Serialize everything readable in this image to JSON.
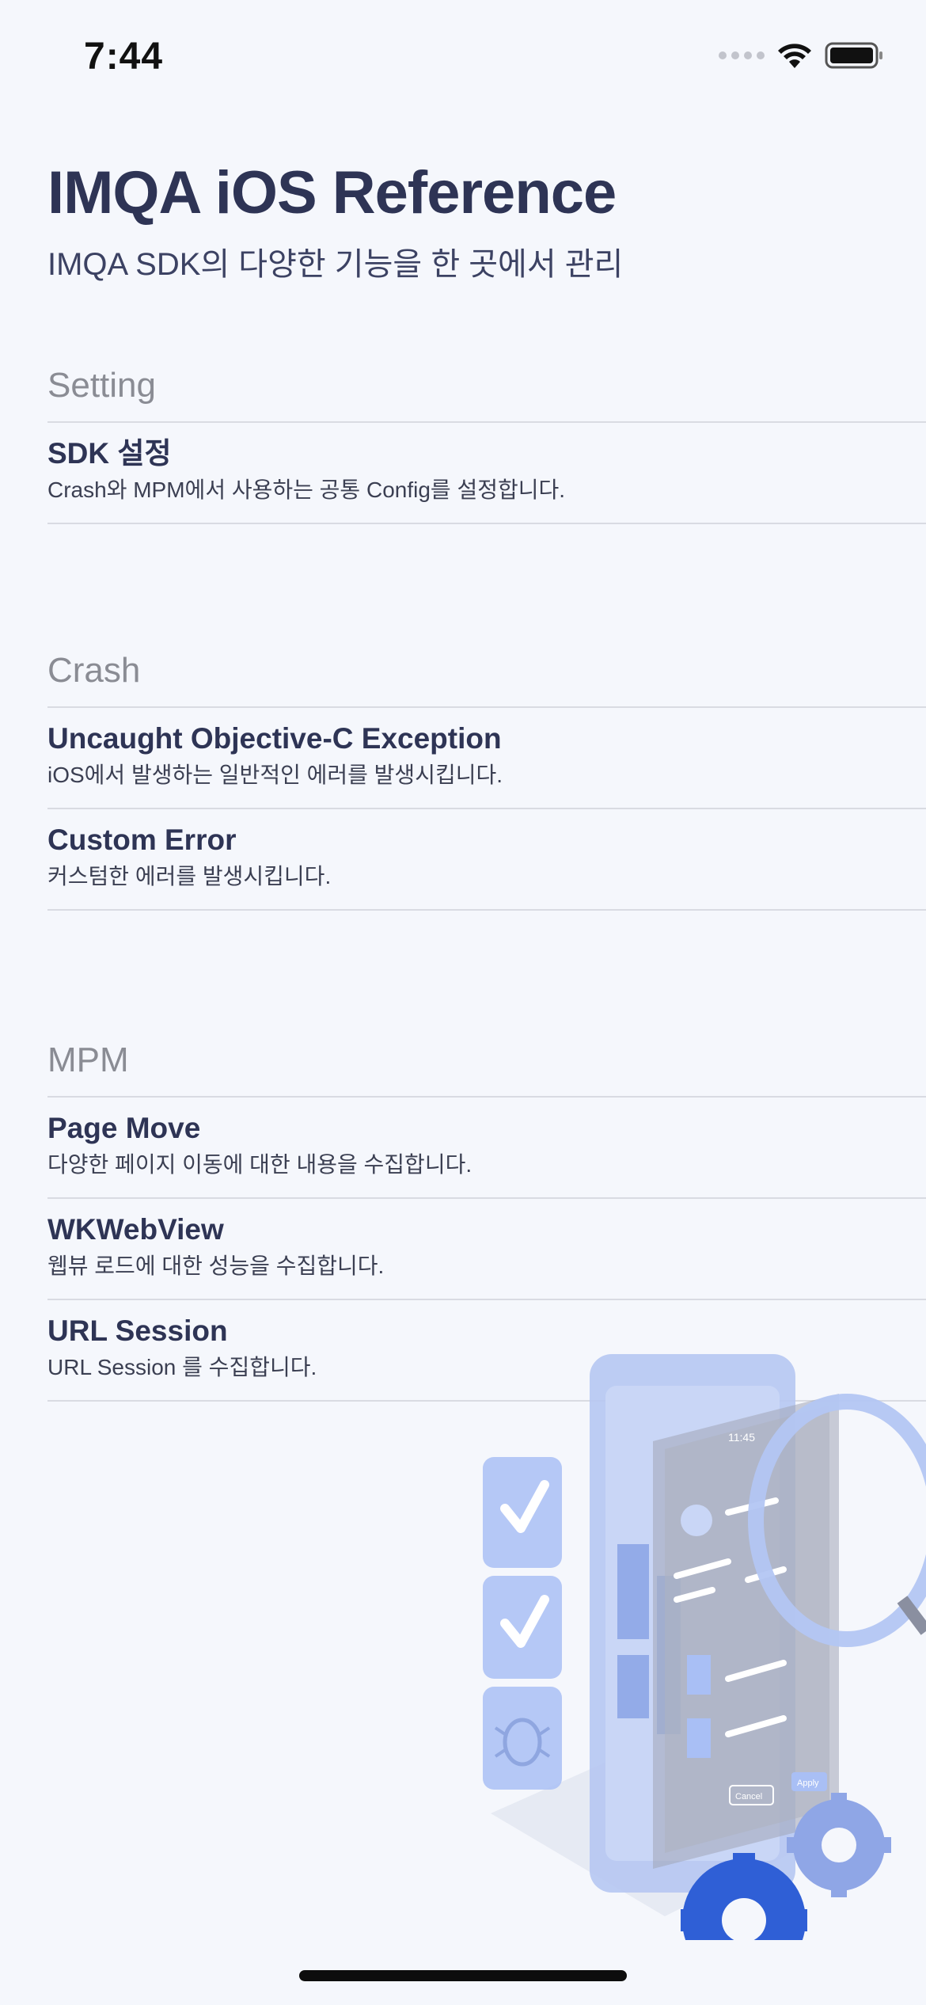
{
  "status_bar": {
    "time": "7:44"
  },
  "header": {
    "title": "IMQA iOS Reference",
    "subtitle": "IMQA SDK의 다양한 기능을 한 곳에서 관리"
  },
  "sections": [
    {
      "header": "Setting",
      "items": [
        {
          "title": "SDK 설정",
          "description": "Crash와 MPM에서 사용하는 공통 Config를 설정합니다."
        }
      ]
    },
    {
      "header": "Crash",
      "items": [
        {
          "title": "Uncaught Objective-C Exception",
          "description": "iOS에서 발생하는 일반적인 에러를 발생시킵니다."
        },
        {
          "title": "Custom Error",
          "description": "커스텀한 에러를 발생시킵니다."
        }
      ]
    },
    {
      "header": "MPM",
      "items": [
        {
          "title": "Page Move",
          "description": "다양한 페이지 이동에 대한 내용을 수집합니다."
        },
        {
          "title": "WKWebView",
          "description": "웹뷰 로드에 대한 성능을 수집합니다."
        },
        {
          "title": "URL Session",
          "description": "URL Session 를 수집합니다."
        }
      ]
    }
  ],
  "illustration": {
    "phone_time": "11:45",
    "cancel_label": "Cancel",
    "apply_label": "Apply"
  },
  "colors": {
    "background": "#f5f7fc",
    "title": "#2e3455",
    "section_header": "#8a8c94",
    "divider": "#d9dbe2",
    "illustration_blue": "#a9bff5",
    "gear_blue": "#2f5fd6"
  }
}
